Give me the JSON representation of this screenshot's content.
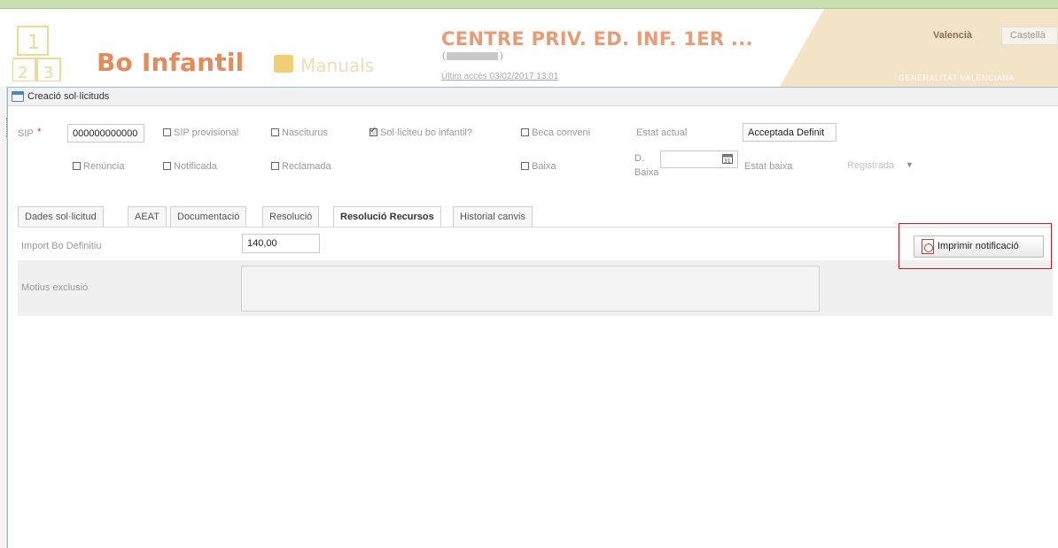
{
  "header": {
    "brand": "Bo Infantil",
    "manuals": "Manuals",
    "centre": "CENTRE PRIV. ED. INF. 1ER ...",
    "centre_sub_open": "(",
    "centre_sub_close": ")",
    "last_access": "Últim accés 03/02/2017 13:01",
    "lang_valencia": "Valencià",
    "lang_castella": "Castellà",
    "gva": "GENERALITAT VALENCIANA"
  },
  "dialog": {
    "title": "Creació sol·licituds"
  },
  "form": {
    "sip_label": "SIP",
    "sip_required": "*",
    "sip_value": "000000000000",
    "sip_provisional": "SIP provisional",
    "nasciturus": "Nasciturus",
    "solliciteu": "Sol·liciteu bo infantil?",
    "beca_conveni": "Beca conveni",
    "estat_actual_label": "Estat actual",
    "estat_actual_value": "Acceptada Definit",
    "renuncia": "Renúncia",
    "notificada": "Notificada",
    "reclamada": "Reclamada",
    "baixa": "Baixa",
    "d_baixa_1": "D.",
    "d_baixa_2": "Baixa",
    "estat_baixa_label": "Estat baixa",
    "estat_baixa_value": "Registrada"
  },
  "tabs": [
    {
      "label": "Dades sol·licitud"
    },
    {
      "label": "AEAT"
    },
    {
      "label": "Documentació"
    },
    {
      "label": "Resolució"
    },
    {
      "label": "Resolució Recursos"
    },
    {
      "label": "Historial canvis"
    }
  ],
  "panel": {
    "import_label": "Import Bo Definitiu",
    "import_value": "140,00",
    "motius_label": "Motius exclusió",
    "motius_value": "",
    "print_label": "Imprimir notificació"
  },
  "colors": {
    "brand": "#e58a5a",
    "highlight_box": "#d01818",
    "header_tan": "#f3e4c8"
  },
  "icons": [
    "calendar-icon",
    "pdf-icon",
    "window-icon",
    "dropdown-arrow-icon",
    "required-asterisk"
  ]
}
